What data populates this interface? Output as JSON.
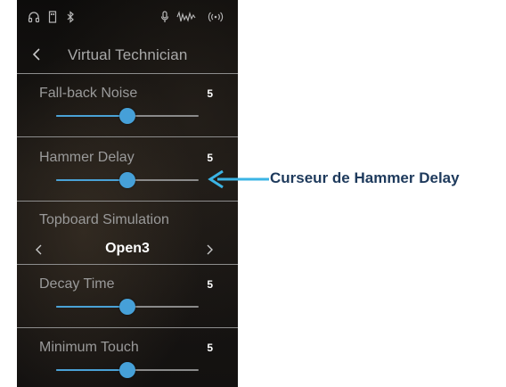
{
  "status_bar": {
    "icons": [
      "headphones-icon",
      "usb-icon",
      "bluetooth-icon",
      "mic-icon",
      "audio-recorder-icon",
      "wireless-icon"
    ]
  },
  "header": {
    "title": "Virtual Technician"
  },
  "settings": {
    "fallback_noise": {
      "label": "Fall-back Noise",
      "value": "5",
      "level": 0.5
    },
    "hammer_delay": {
      "label": "Hammer Delay",
      "value": "5",
      "level": 0.5
    },
    "topboard": {
      "label": "Topboard Simulation",
      "value": "Open3"
    },
    "decay_time": {
      "label": "Decay Time",
      "value": "5",
      "level": 0.5
    },
    "minimum_touch": {
      "label": "Minimum Touch",
      "value": "5",
      "level": 0.5
    }
  },
  "callout": {
    "text": "Curseur de Hammer Delay"
  },
  "colors": {
    "accent": "#46a0d8",
    "callout_text": "#1e3a5c",
    "arrow": "#3bb4e5"
  }
}
